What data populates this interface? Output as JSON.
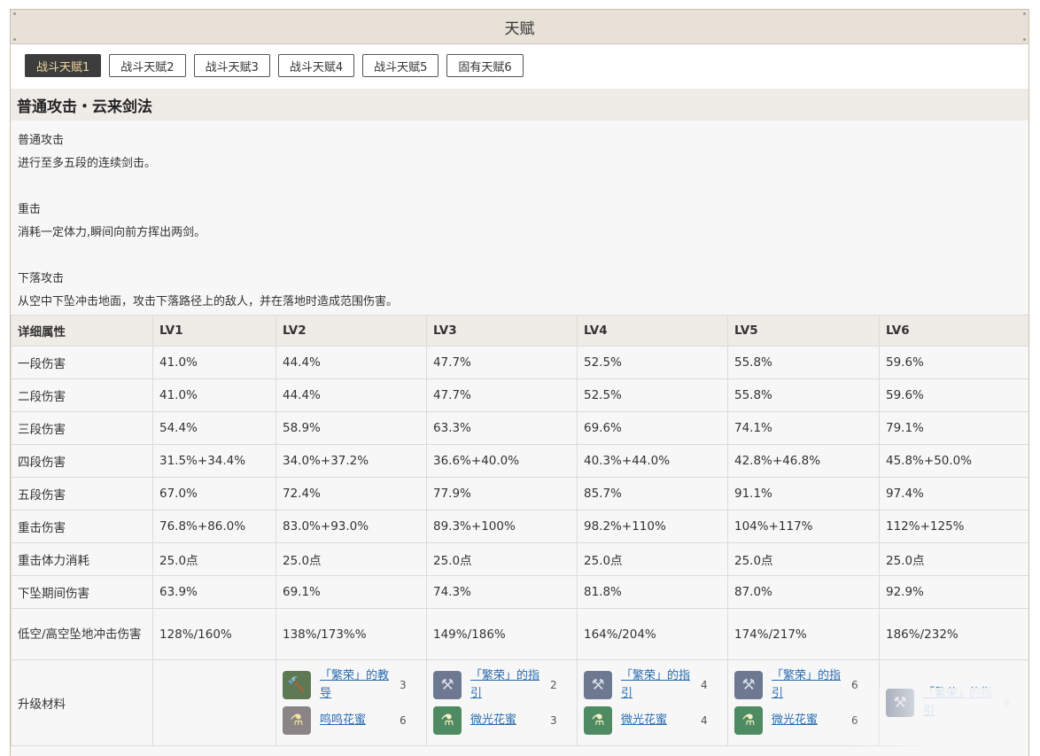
{
  "header": {
    "title": "天赋"
  },
  "tabs": [
    {
      "label": "战斗天赋1",
      "active": true
    },
    {
      "label": "战斗天赋2"
    },
    {
      "label": "战斗天赋3"
    },
    {
      "label": "战斗天赋4"
    },
    {
      "label": "战斗天赋5"
    },
    {
      "label": "固有天赋6"
    }
  ],
  "section": {
    "title": "普通攻击・云来剑法",
    "desc": [
      {
        "name": "普通攻击",
        "text": "进行至多五段的连续剑击。"
      },
      {
        "name": "重击",
        "text": "消耗一定体力,瞬间向前方挥出两剑。"
      },
      {
        "name": "下落攻击",
        "text": "从空中下坠冲击地面，攻击下落路径上的敌人，并在落地时造成范围伤害。"
      }
    ]
  },
  "table": {
    "headers": [
      "详细属性",
      "LV1",
      "LV2",
      "LV3",
      "LV4",
      "LV5",
      "LV6"
    ],
    "rows": [
      [
        "一段伤害",
        "41.0%",
        "44.4%",
        "47.7%",
        "52.5%",
        "55.8%",
        "59.6%"
      ],
      [
        "二段伤害",
        "41.0%",
        "44.4%",
        "47.7%",
        "52.5%",
        "55.8%",
        "59.6%"
      ],
      [
        "三段伤害",
        "54.4%",
        "58.9%",
        "63.3%",
        "69.6%",
        "74.1%",
        "79.1%"
      ],
      [
        "四段伤害",
        "31.5%+34.4%",
        "34.0%+37.2%",
        "36.6%+40.0%",
        "40.3%+44.0%",
        "42.8%+46.8%",
        "45.8%+50.0%"
      ],
      [
        "五段伤害",
        "67.0%",
        "72.4%",
        "77.9%",
        "85.7%",
        "91.1%",
        "97.4%"
      ],
      [
        "重击伤害",
        "76.8%+86.0%",
        "83.0%+93.0%",
        "89.3%+100%",
        "98.2%+110%",
        "104%+117%",
        "112%+125%"
      ],
      [
        "重击体力消耗",
        "25.0点",
        "25.0点",
        "25.0点",
        "25.0点",
        "25.0点",
        "25.0点"
      ],
      [
        "下坠期间伤害",
        "63.9%",
        "69.1%",
        "74.3%",
        "81.8%",
        "87.0%",
        "92.9%"
      ],
      [
        "低空/高空坠地冲击伤害",
        "128%/160%",
        "138%/173%%",
        "149%/186%",
        "164%/204%",
        "174%/217%",
        "186%/232%"
      ]
    ],
    "materials_label": "升级材料",
    "materials": [
      [],
      [
        {
          "name": "「繁荣」的教导",
          "qty": "3",
          "icon": "book-icon"
        },
        {
          "name": "鸣鸣花蜜",
          "qty": "6",
          "icon": "nectar-icon"
        }
      ],
      [
        {
          "name": "「繁荣」的指引",
          "qty": "2",
          "icon": "guide-icon"
        },
        {
          "name": "微光花蜜",
          "qty": "3",
          "icon": "nectar-icon"
        }
      ],
      [
        {
          "name": "「繁荣」的指引",
          "qty": "4",
          "icon": "guide-icon"
        },
        {
          "name": "微光花蜜",
          "qty": "4",
          "icon": "nectar-icon"
        }
      ],
      [
        {
          "name": "「繁荣」的指引",
          "qty": "6",
          "icon": "guide-icon"
        },
        {
          "name": "微光花蜜",
          "qty": "6",
          "icon": "nectar-icon"
        }
      ],
      [
        {
          "name": "「繁荣」的指引",
          "qty": "9",
          "icon": "guide-icon"
        }
      ]
    ]
  }
}
